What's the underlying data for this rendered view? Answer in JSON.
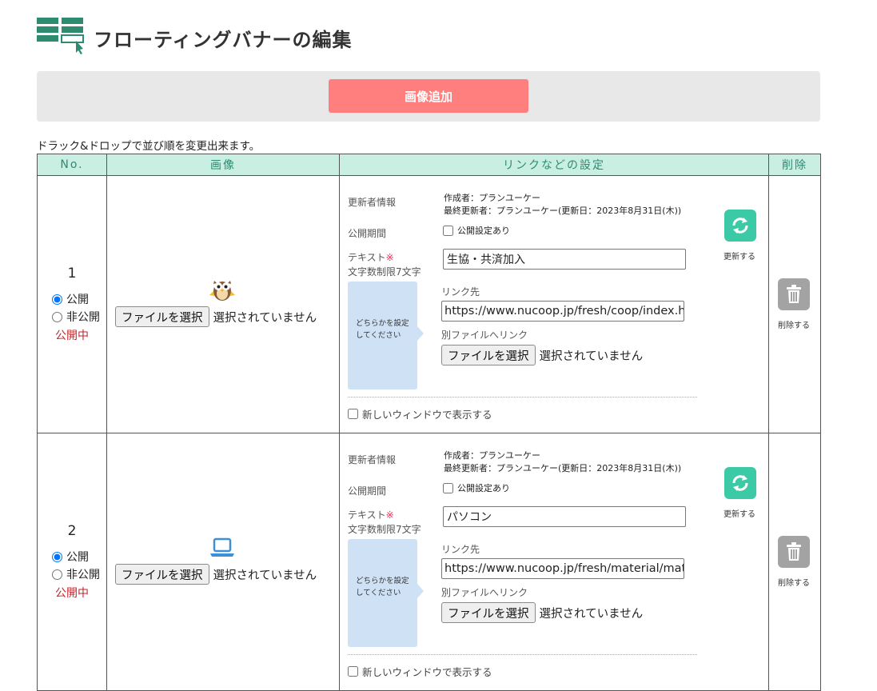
{
  "page": {
    "title": "フローティングバナーの編集"
  },
  "toolbar": {
    "add_button": "画像追加",
    "hint": "ドラック&ドロップで並び順を変更出来ます。"
  },
  "table": {
    "headers": [
      "No.",
      "画像",
      "リンクなどの設定",
      "削除"
    ]
  },
  "labels": {
    "updater_info": "更新者情報",
    "period": "公開期間",
    "text": "テキスト",
    "required_mark": "※",
    "text_limit": "文字数制限7文字",
    "either": "どちらかを設定してください",
    "link_to": "リンク先",
    "file_link": "別ファイルへリンク",
    "new_window": "新しいウィンドウで表示する",
    "update": "更新する",
    "delete": "削除する",
    "public": "公開",
    "private": "非公開",
    "period_check": "公開設定あり",
    "file_button": "ファイルを選択",
    "no_file": "選択されていません"
  },
  "rows": [
    {
      "no": "1",
      "status": "公開中",
      "visibility": "public",
      "icon": "owl-icon",
      "creator": "作成者：プランユーケー",
      "last_updater": "最終更新者：プランユーケー(更新日：2023年8月31日(木))",
      "text_value": "生協・共済加入",
      "url": "https://www.nucoop.jp/fresh/coop/index.html",
      "period_checked": false,
      "new_window_checked": false
    },
    {
      "no": "2",
      "status": "公開中",
      "visibility": "public",
      "icon": "laptop-icon",
      "creator": "作成者：プランユーケー",
      "last_updater": "最終更新者：プランユーケー(更新日：2023年8月31日(木))",
      "text_value": "パソコン",
      "url": "https://www.nucoop.jp/fresh/material/material.html",
      "period_checked": false,
      "new_window_checked": false
    }
  ],
  "colors": {
    "accent_green": "#2f8a72",
    "header_bg": "#c9eee2",
    "add_button": "#ff7f7f",
    "update_button": "#3cc9a6",
    "delete_button": "#a3a3a3",
    "status_red": "#c0272d",
    "either_box": "#cfe2f5"
  }
}
